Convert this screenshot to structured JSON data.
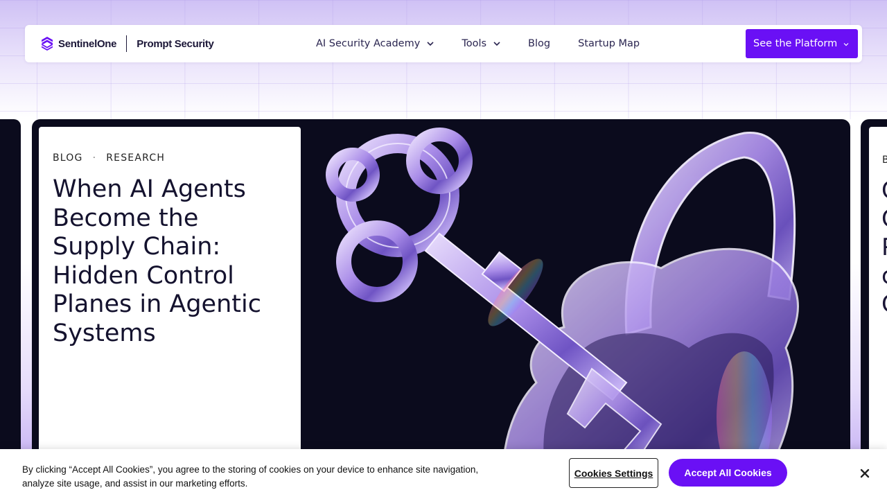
{
  "nav": {
    "brand_primary": "SentinelOne",
    "brand_secondary": "Prompt Security",
    "links": [
      {
        "label": "AI Security Academy",
        "has_dropdown": true
      },
      {
        "label": "Tools",
        "has_dropdown": true
      },
      {
        "label": "Blog",
        "has_dropdown": false
      },
      {
        "label": "Startup Map",
        "has_dropdown": false
      }
    ],
    "cta_label": "See the Platform"
  },
  "featured": {
    "tag_1": "BLOG",
    "separator": "·",
    "tag_2": "RESEARCH",
    "title": "When AI Agents Become the Supply Chain: Hidden Control Planes in Agentic Systems",
    "image_icon": "crystal-key-padlock-illustration"
  },
  "next_card": {
    "tag_partial": "B",
    "letters": [
      "C",
      "C",
      "P",
      "c",
      "C"
    ]
  },
  "cookie": {
    "text": "By clicking “Accept All Cookies”, you agree to the storing of cookies on your device to enhance site navigation, analyze site usage, and assist in our marketing efforts.",
    "settings_label": "Cookies Settings",
    "accept_label": "Accept All Cookies",
    "close_icon": "close-icon"
  },
  "colors": {
    "accent": "#6a10f5",
    "card_dark": "#0b0b1d",
    "text_dark": "#14122e"
  }
}
